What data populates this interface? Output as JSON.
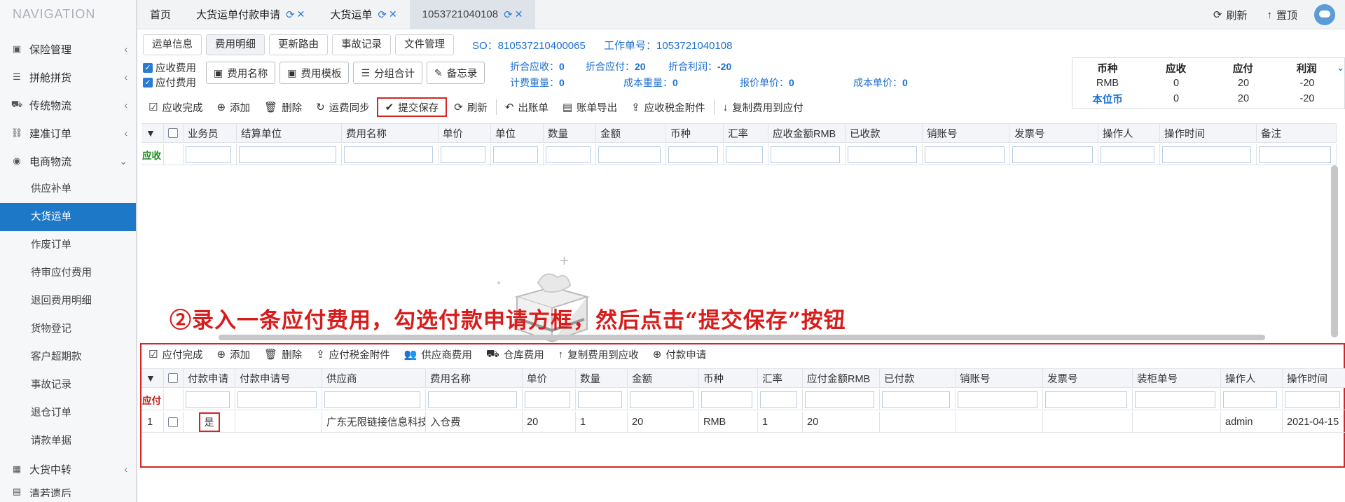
{
  "sidebar": {
    "title": "NAVIGATION",
    "items": [
      {
        "label": "保险管理",
        "icon": "insurance-icon"
      },
      {
        "label": "拼舱拼货",
        "icon": "consolidation-icon"
      },
      {
        "label": "传统物流",
        "icon": "truck-icon"
      },
      {
        "label": "建准订单",
        "icon": "link-icon"
      },
      {
        "label": "电商物流",
        "icon": "globe-icon"
      }
    ],
    "sub_items": [
      "供应补单",
      "大货运单",
      "作废订单",
      "待审应付费用",
      "退回费用明细",
      "货物登记",
      "客户超期款",
      "事故记录",
      "退仓订单",
      "请款单据"
    ],
    "bottom_items": [
      {
        "label": "大货中转",
        "icon": "grid-icon"
      },
      {
        "label": "清若遗后",
        "icon": "item-icon"
      }
    ]
  },
  "tabs": {
    "home": "首页",
    "t1": "大货运单付款申请",
    "t2": "大货运单",
    "t3": "1053721040108",
    "refresh": "刷新",
    "top": "置顶"
  },
  "subtabs": [
    "运单信息",
    "费用明细",
    "更新路由",
    "事故记录",
    "文件管理"
  ],
  "so": {
    "so_label": "SO：810537210400065",
    "work_label": "工作单号：1053721040108"
  },
  "checks": {
    "receivable": "应收费用",
    "payable": "应付费用"
  },
  "buttons": {
    "fee_name": "费用名称",
    "fee_template": "费用模板",
    "group_total": "分组合计",
    "memo": "备忘录"
  },
  "summary": {
    "l1": [
      [
        "折合应收：",
        "0"
      ],
      [
        "折合应付：",
        "20"
      ],
      [
        "折合利润：",
        "-20"
      ]
    ],
    "l2": [
      [
        "计费重量：",
        "0"
      ],
      [
        "成本重量：",
        "0"
      ],
      [
        "报价单价：",
        "0"
      ],
      [
        "成本单价：",
        "0"
      ]
    ]
  },
  "currency": {
    "headers": [
      "币种",
      "应收",
      "应付",
      "利润"
    ],
    "rows": [
      [
        "RMB",
        "0",
        "20",
        "-20"
      ],
      [
        "本位币",
        "0",
        "20",
        "-20"
      ]
    ],
    "accent": "#1e6fd0"
  },
  "toolbar1": [
    "应收完成",
    "添加",
    "删除",
    "运费同步",
    "提交保存",
    "刷新",
    "出账单",
    "账单导出",
    "应收税金附件",
    "复制费用到应付"
  ],
  "grid1": {
    "row_label": "应收",
    "columns": [
      "业务员",
      "结算单位",
      "费用名称",
      "单价",
      "单位",
      "数量",
      "金额",
      "币种",
      "汇率",
      "应收金额RMB",
      "已收款",
      "销账号",
      "发票号",
      "操作人",
      "操作时间",
      "备注"
    ]
  },
  "annotation": "②录入一条应付费用，勾选付款申请方框，然后点击“提交保存”按钮",
  "toolbar2": [
    "应付完成",
    "添加",
    "删除",
    "应付税金附件",
    "供应商费用",
    "仓库费用",
    "复制费用到应收",
    "付款申请"
  ],
  "grid2": {
    "row_label": "应付",
    "columns": [
      "付款申请",
      "付款申请号",
      "供应商",
      "费用名称",
      "单价",
      "数量",
      "金额",
      "币种",
      "汇率",
      "应付金额RMB",
      "已付款",
      "销账号",
      "发票号",
      "装柜单号",
      "操作人",
      "操作时间"
    ],
    "rows": [
      {
        "index": "1",
        "apply": "是",
        "apply_no": "",
        "supplier": "广东无限链接信息科技",
        "fee": "入仓费",
        "price": "20",
        "qty": "1",
        "amount": "20",
        "currency": "RMB",
        "rate": "1",
        "rmb": "20",
        "paid": "",
        "writeoff": "",
        "invoice": "",
        "container": "",
        "operator": "admin",
        "time": "2021-04-15"
      }
    ]
  }
}
